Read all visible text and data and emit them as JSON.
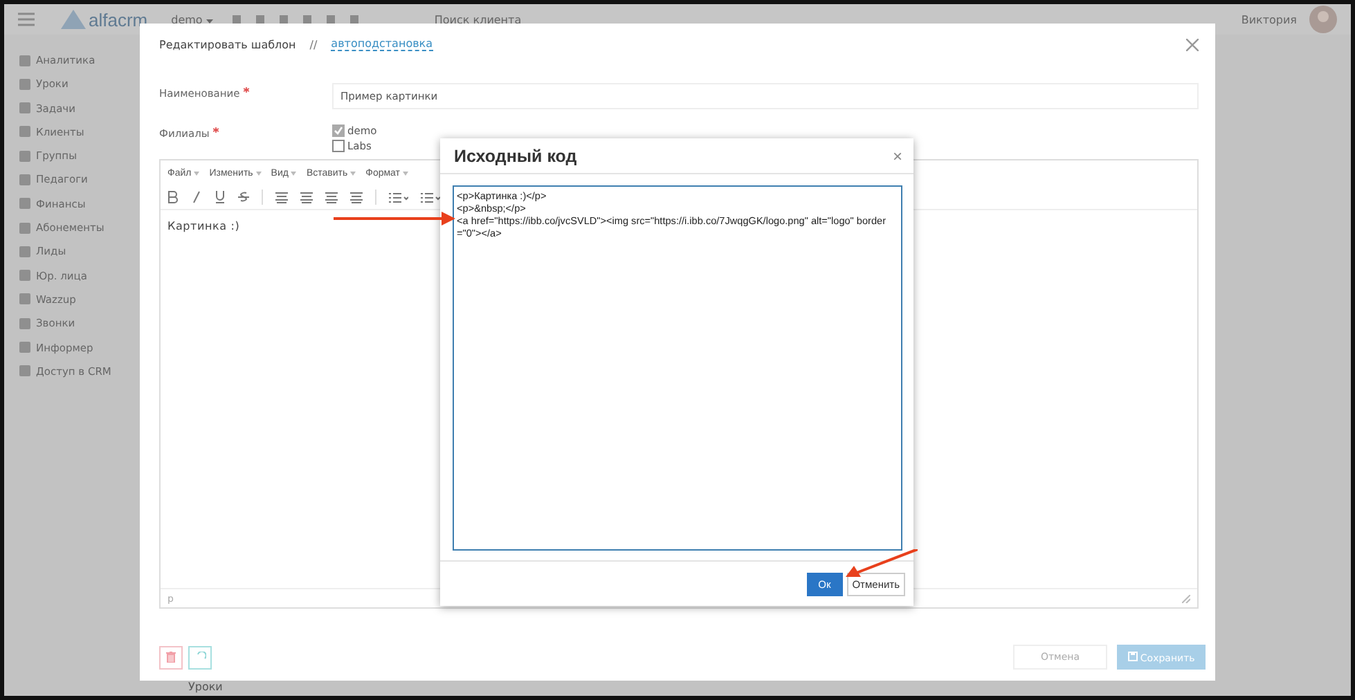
{
  "topbar": {
    "logo": "alfacrm",
    "branch": "demo",
    "search_placeholder": "Поиск клиента",
    "user": "Виктория"
  },
  "sidebar": {
    "items": [
      {
        "label": "Аналитика"
      },
      {
        "label": "Уроки"
      },
      {
        "label": "Задачи"
      },
      {
        "label": "Клиенты"
      },
      {
        "label": "Группы"
      },
      {
        "label": "Педагоги"
      },
      {
        "label": "Финансы"
      },
      {
        "label": "Абонементы"
      },
      {
        "label": "Лиды"
      },
      {
        "label": "Юр. лица"
      },
      {
        "label": "Wazzup"
      },
      {
        "label": "Звонки"
      },
      {
        "label": "Информер"
      },
      {
        "label": "Доступ в CRM"
      }
    ]
  },
  "background_text": "Уроки",
  "modal": {
    "title": "Редактировать шаблон",
    "separator": "//",
    "link": "автоподстановка",
    "name_field": {
      "label": "Наименование",
      "required": true,
      "value": "Пример картинки"
    },
    "branches": {
      "label": "Филиалы",
      "required": true,
      "options": [
        {
          "label": "demo",
          "checked": true
        },
        {
          "label": "Labs",
          "checked": false
        }
      ]
    },
    "editor": {
      "menu": [
        "Файл",
        "Изменить",
        "Вид",
        "Вставить",
        "Формат"
      ],
      "content": "Картинка :)",
      "status_path": "p"
    },
    "cancel": "Отмена",
    "save": "Сохранить"
  },
  "dialog": {
    "title": "Исходный код",
    "close": "×",
    "code_lines": [
      "<p>Картинка :)</p>",
      "<p>&nbsp;</p>",
      "<a href=\"https://ibb.co/jvcSVLD\"><img src=\"https://i.ibb.co/7JwqgGK/logo.png\" alt=\"logo\" border=\"0\"></a>"
    ],
    "ok": "Ок",
    "cancel": "Отменить"
  }
}
